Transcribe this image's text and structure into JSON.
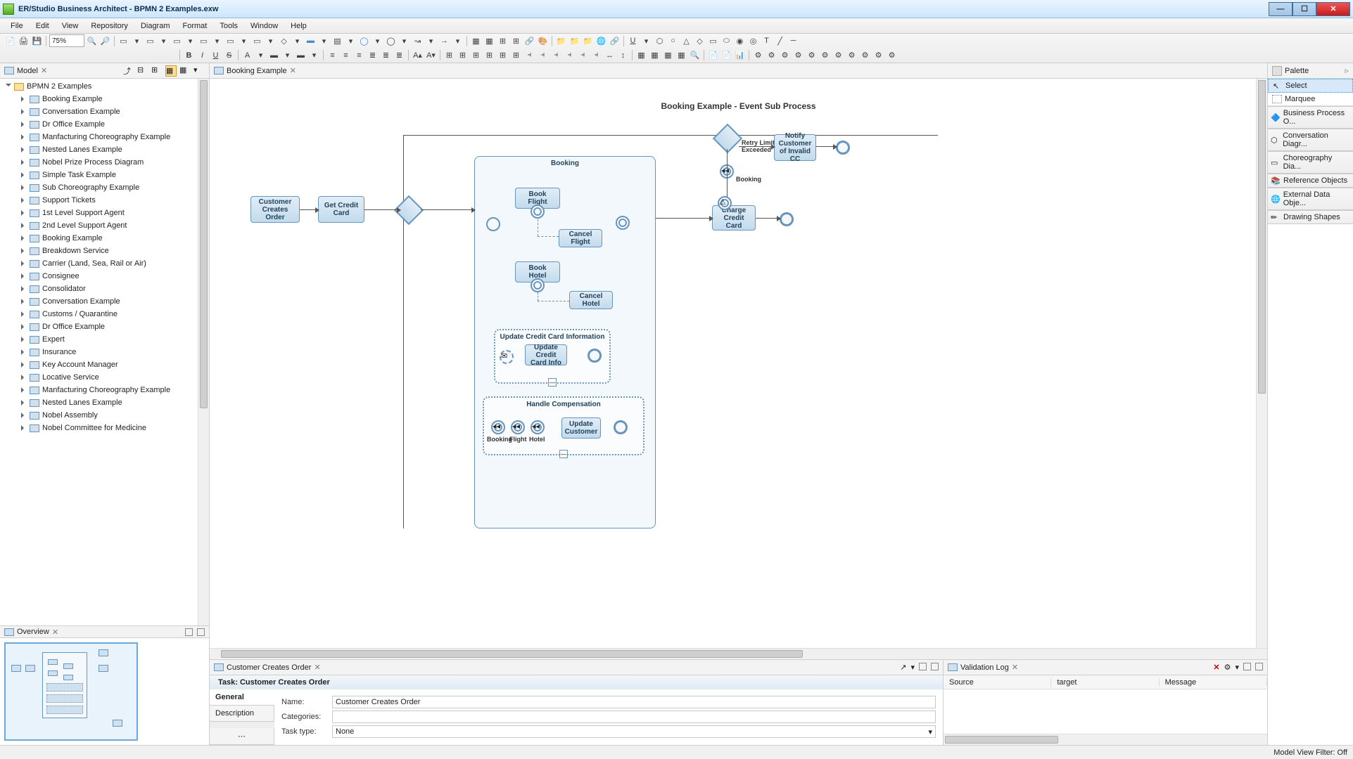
{
  "title": "ER/Studio Business Architect - BPMN 2 Examples.exw",
  "menu": [
    "File",
    "Edit",
    "View",
    "Repository",
    "Diagram",
    "Format",
    "Tools",
    "Window",
    "Help"
  ],
  "zoom": "75%",
  "modelView": {
    "title": "Model"
  },
  "tree": {
    "root": "BPMN 2 Examples",
    "children": [
      "Booking Example",
      "Conversation Example",
      "Dr Office Example",
      "Manfacturing Choreography Example",
      "Nested Lanes Example",
      "Nobel Prize Process Diagram",
      "Simple Task Example",
      "Sub Choreography Example",
      "Support Tickets"
    ],
    "participants": [
      "1st Level Support Agent",
      "2nd Level Support Agent",
      "Booking Example",
      "Breakdown Service",
      "Carrier (Land, Sea, Rail or Air)",
      "Consignee",
      "Consolidator",
      "Conversation Example",
      "Customs / Quarantine",
      "Dr Office Example",
      "Expert",
      "Insurance",
      "Key Account Manager",
      "Locative Service",
      "Manfacturing Choreography Example",
      "Nested Lanes Example",
      "Nobel Assembly",
      "Nobel Committee for Medicine"
    ]
  },
  "overview": {
    "title": "Overview"
  },
  "editorTab": "Booking Example",
  "diagram": {
    "title": "Booking Example - Event Sub Process",
    "tasks": {
      "customerCreates": "Customer Creates Order",
      "getCredit": "Get Credit Card",
      "booking": "Booking",
      "bookFlight": "Book Flight",
      "cancelFlight": "Cancel Flight",
      "bookHotel": "Book Hotel",
      "cancelHotel": "Cancel Hotel",
      "updateCCInfo": "Update Credit Card Info",
      "updateCustomer": "Update Customer",
      "chargeCredit": "Charge Credit Card",
      "notifyInvalid": "Notify Customer of Invalid CC"
    },
    "subprocess": {
      "updateCC": "Update Credit Card Information",
      "handleComp": "Handle Compensation"
    },
    "labels": {
      "retry": "Retry Limit Exceeded",
      "bookingRef": "Booking",
      "compBooking": "Booking",
      "compFlight": "Flight",
      "compHotel": "Hotel"
    }
  },
  "palette": {
    "title": "Palette",
    "tools": [
      "Select",
      "Marquee"
    ],
    "drawers": [
      "Business Process O...",
      "Conversation Diagr...",
      "Choreography  Dia...",
      "Reference Objects",
      "External Data Obje...",
      "Drawing Shapes"
    ]
  },
  "propTab": "Customer Creates Order",
  "propHeader": "Task: Customer Creates Order",
  "sideTabs": [
    "General",
    "Description"
  ],
  "prop": {
    "nameLabel": "Name:",
    "nameValue": "Customer Creates Order",
    "catLabel": "Categories:",
    "catValue": "",
    "typeLabel": "Task type:",
    "typeValue": "None"
  },
  "validation": {
    "title": "Validation Log",
    "cols": [
      "Source",
      "target",
      "Message"
    ]
  },
  "status": "Model View Filter: Off"
}
